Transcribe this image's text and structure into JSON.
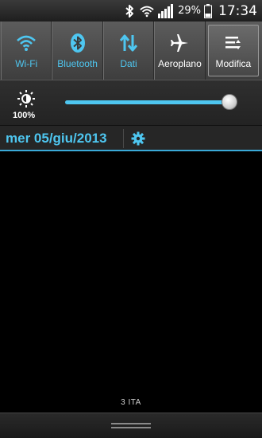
{
  "status_bar": {
    "icons": [
      "bluetooth-icon",
      "wifi-icon",
      "signal-icon",
      "battery-icon"
    ],
    "battery_percent": "29%",
    "time": "17:34"
  },
  "quick_settings": {
    "toggles": [
      {
        "label": "Wi-Fi",
        "icon": "wifi-icon",
        "state": "on"
      },
      {
        "label": "Bluetooth",
        "icon": "bluetooth-icon",
        "state": "on"
      },
      {
        "label": "Dati",
        "icon": "data-arrows-icon",
        "state": "on"
      },
      {
        "label": "Aeroplano",
        "icon": "airplane-icon",
        "state": "off"
      },
      {
        "label": "Modifica",
        "icon": "edit-toggles-icon",
        "state": "off"
      }
    ]
  },
  "brightness": {
    "label": "100%",
    "level": 1.0,
    "icon": "brightness-icon"
  },
  "date_row": {
    "date": "mer 05/giu/2013",
    "settings_icon": "gear-icon"
  },
  "footer": {
    "carrier": "3 ITA"
  },
  "colors": {
    "accent": "#4ec6f0",
    "background": "#000000"
  }
}
